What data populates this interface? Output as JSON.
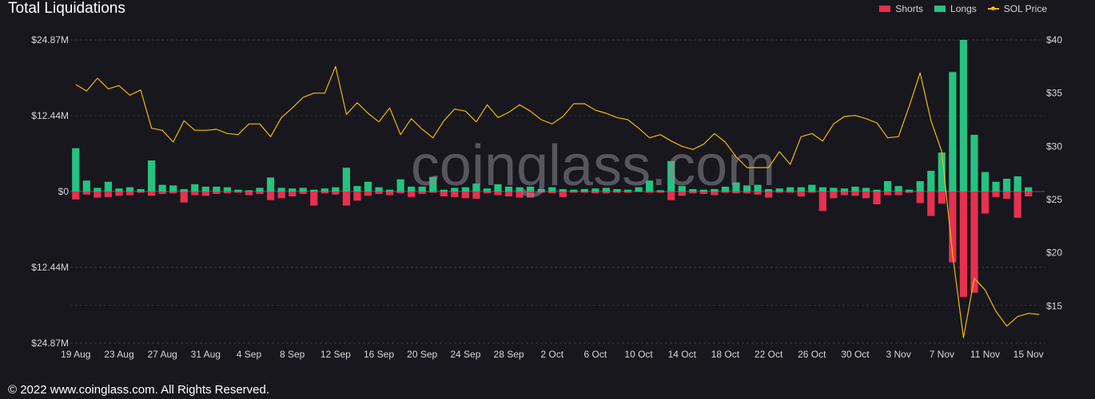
{
  "header": {
    "title": "Total Liquidations"
  },
  "legend": [
    {
      "label": "Shorts",
      "color": "#e8304f"
    },
    {
      "label": "Longs",
      "color": "#26c281"
    },
    {
      "label": "SOL Price",
      "color": "#f0b90b"
    }
  ],
  "watermark": "coinglass.com",
  "footer": "© 2022 www.coinglass.com. All Rights Reserved.",
  "chart_data": {
    "type": "bar",
    "title": "Total Liquidations",
    "categories": [
      "19 Aug",
      "20 Aug",
      "21 Aug",
      "22 Aug",
      "23 Aug",
      "24 Aug",
      "25 Aug",
      "26 Aug",
      "27 Aug",
      "28 Aug",
      "29 Aug",
      "30 Aug",
      "31 Aug",
      "1 Sep",
      "2 Sep",
      "3 Sep",
      "4 Sep",
      "5 Sep",
      "6 Sep",
      "7 Sep",
      "8 Sep",
      "9 Sep",
      "10 Sep",
      "11 Sep",
      "12 Sep",
      "13 Sep",
      "14 Sep",
      "15 Sep",
      "16 Sep",
      "17 Sep",
      "18 Sep",
      "19 Sep",
      "20 Sep",
      "21 Sep",
      "22 Sep",
      "23 Sep",
      "24 Sep",
      "25 Sep",
      "26 Sep",
      "27 Sep",
      "28 Sep",
      "29 Sep",
      "30 Sep",
      "1 Oct",
      "2 Oct",
      "3 Oct",
      "4 Oct",
      "5 Oct",
      "6 Oct",
      "7 Oct",
      "8 Oct",
      "9 Oct",
      "10 Oct",
      "11 Oct",
      "12 Oct",
      "13 Oct",
      "14 Oct",
      "15 Oct",
      "16 Oct",
      "17 Oct",
      "18 Oct",
      "19 Oct",
      "20 Oct",
      "21 Oct",
      "22 Oct",
      "23 Oct",
      "24 Oct",
      "25 Oct",
      "26 Oct",
      "27 Oct",
      "28 Oct",
      "29 Oct",
      "30 Oct",
      "31 Oct",
      "1 Nov",
      "2 Nov",
      "3 Nov",
      "4 Nov",
      "5 Nov",
      "6 Nov",
      "7 Nov",
      "8 Nov",
      "9 Nov",
      "10 Nov",
      "11 Nov",
      "12 Nov",
      "13 Nov",
      "14 Nov",
      "15 Nov",
      "16 Nov"
    ],
    "x_tick_labels": [
      "19 Aug",
      "23 Aug",
      "27 Aug",
      "31 Aug",
      "4 Sep",
      "8 Sep",
      "12 Sep",
      "16 Sep",
      "20 Sep",
      "24 Sep",
      "28 Sep",
      "2 Oct",
      "6 Oct",
      "10 Oct",
      "14 Oct",
      "18 Oct",
      "22 Oct",
      "26 Oct",
      "30 Oct",
      "3 Nov",
      "7 Nov",
      "11 Nov",
      "15 Nov"
    ],
    "y_ticks_left": [
      "$24.87M",
      "$12.44M",
      "$0",
      "$12.44M",
      "$24.87M"
    ],
    "y_ticks_right": [
      "$40",
      "$35",
      "$30",
      "$25",
      "$20",
      "$15"
    ],
    "ylim_liquidations_musd": [
      -24.87,
      24.87
    ],
    "ylim_price_usd": [
      11.5,
      40
    ],
    "grid": true,
    "legend_position": "top-right",
    "series": [
      {
        "name": "Longs",
        "unit": "$M",
        "values": [
          7.1,
          1.8,
          0.6,
          1.6,
          0.5,
          0.7,
          0.4,
          5.1,
          1.1,
          1.0,
          0.4,
          1.2,
          0.8,
          0.8,
          0.7,
          0.3,
          0.2,
          0.6,
          2.3,
          0.6,
          0.5,
          0.6,
          0.3,
          0.5,
          0.7,
          3.9,
          0.9,
          1.6,
          0.7,
          0.3,
          2.0,
          0.8,
          0.8,
          2.4,
          0.3,
          0.6,
          0.7,
          1.3,
          0.5,
          1.2,
          0.8,
          0.7,
          0.8,
          0.4,
          0.7,
          0.4,
          0.3,
          0.4,
          0.5,
          0.6,
          0.4,
          0.3,
          0.7,
          1.8,
          0.2,
          5.0,
          0.9,
          0.4,
          0.3,
          0.4,
          0.8,
          1.5,
          1.0,
          1.1,
          0.4,
          0.5,
          0.7,
          0.7,
          1.1,
          0.7,
          0.6,
          0.5,
          0.8,
          0.6,
          0.3,
          1.7,
          0.9,
          0.3,
          1.7,
          3.4,
          6.4,
          19.6,
          24.87,
          9.3,
          3.2,
          1.6,
          2.1,
          2.5,
          0.7,
          0.0
        ]
      },
      {
        "name": "Shorts",
        "unit": "$M",
        "values": [
          1.3,
          0.5,
          1.0,
          0.9,
          0.7,
          0.6,
          0.2,
          0.7,
          0.4,
          0.3,
          1.8,
          0.6,
          0.7,
          0.4,
          0.3,
          0.2,
          0.6,
          0.4,
          1.4,
          1.1,
          0.8,
          0.4,
          2.3,
          0.3,
          0.5,
          2.3,
          1.5,
          0.7,
          0.4,
          0.6,
          0.3,
          0.9,
          0.4,
          0.2,
          0.8,
          0.9,
          1.1,
          1.2,
          0.3,
          0.6,
          0.8,
          1.0,
          1.0,
          0.2,
          0.3,
          0.9,
          0.2,
          0.2,
          0.3,
          0.3,
          0.2,
          0.2,
          0.1,
          0.2,
          0.2,
          1.4,
          0.7,
          0.3,
          0.4,
          0.6,
          0.2,
          0.3,
          0.3,
          0.5,
          1.0,
          0.2,
          0.2,
          0.8,
          0.2,
          3.2,
          1.1,
          0.6,
          0.7,
          1.1,
          2.1,
          0.6,
          0.6,
          0.2,
          1.9,
          4.0,
          2.0,
          11.6,
          17.3,
          16.6,
          3.6,
          0.9,
          1.2,
          4.3,
          0.8,
          0.0
        ]
      },
      {
        "name": "SOL Price",
        "unit": "$",
        "values": [
          35.8,
          35.2,
          36.4,
          35.4,
          35.7,
          34.8,
          35.3,
          31.7,
          31.5,
          30.4,
          32.4,
          31.5,
          31.5,
          31.6,
          31.2,
          31.1,
          32.1,
          32.1,
          30.9,
          32.7,
          33.6,
          34.6,
          35.0,
          35.0,
          37.5,
          33.0,
          34.1,
          33.1,
          32.3,
          33.6,
          31.1,
          32.6,
          31.6,
          30.8,
          32.4,
          33.5,
          33.3,
          32.3,
          33.9,
          32.7,
          33.2,
          33.9,
          33.3,
          32.5,
          32.1,
          32.8,
          34.0,
          34.0,
          33.4,
          33.1,
          32.7,
          32.5,
          31.7,
          30.8,
          31.1,
          30.5,
          30.0,
          29.7,
          30.2,
          31.2,
          30.4,
          29.0,
          28.0,
          28.0,
          28.0,
          29.5,
          28.3,
          30.9,
          31.2,
          30.5,
          32.1,
          32.8,
          32.9,
          32.6,
          32.2,
          30.8,
          30.9,
          33.8,
          36.9,
          32.4,
          29.5,
          19.8,
          12.0,
          17.6,
          16.5,
          14.5,
          13.1,
          14.0,
          14.3,
          14.2
        ]
      }
    ]
  }
}
